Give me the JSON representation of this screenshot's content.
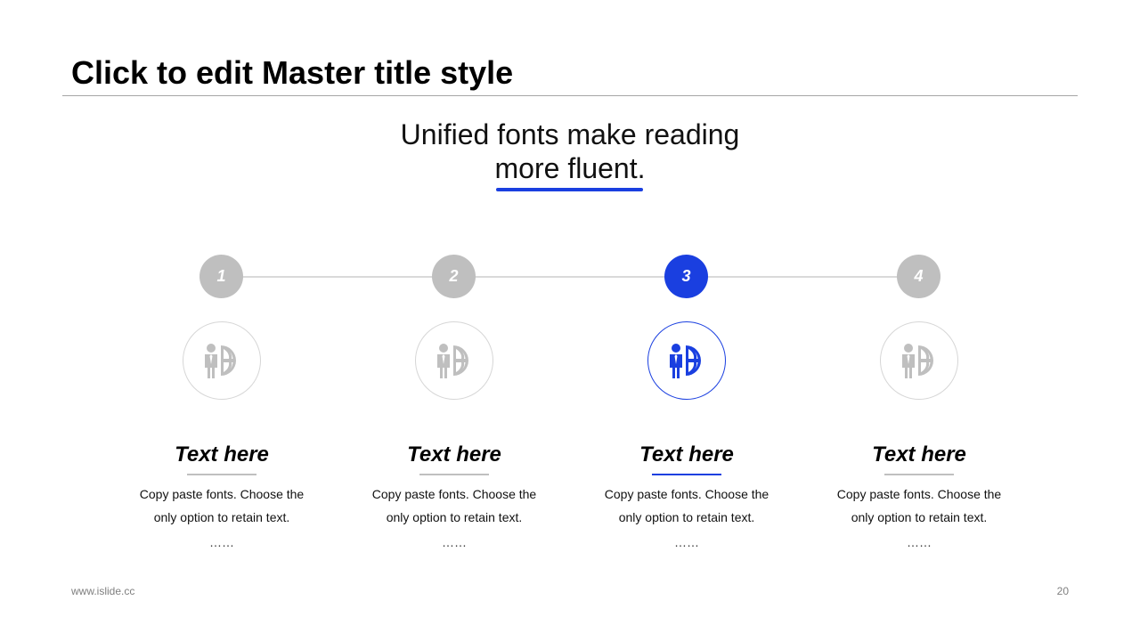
{
  "title": "Click to edit Master title style",
  "subtitle": {
    "line1": "Unified fonts make reading",
    "line2": "more fluent."
  },
  "colors": {
    "accent": "#1a3fe0",
    "inactive": "#bfbfbf",
    "ring": "#d6d6d6",
    "rule": "#a6a6a6"
  },
  "steps": [
    {
      "number": "1",
      "icon": "person-globe-icon",
      "title": "Text here",
      "desc_line1": "Copy paste fonts. Choose the",
      "desc_line2": "only option to retain text.",
      "dots": "……",
      "active": false
    },
    {
      "number": "2",
      "icon": "person-globe-icon",
      "title": "Text here",
      "desc_line1": "Copy paste fonts. Choose the",
      "desc_line2": "only option to retain text.",
      "dots": "……",
      "active": false
    },
    {
      "number": "3",
      "icon": "person-globe-icon",
      "title": "Text here",
      "desc_line1": "Copy paste fonts. Choose the",
      "desc_line2": "only option to retain text.",
      "dots": "……",
      "active": true
    },
    {
      "number": "4",
      "icon": "person-globe-icon",
      "title": "Text here",
      "desc_line1": "Copy paste fonts. Choose the",
      "desc_line2": "only option to retain text.",
      "dots": "……",
      "active": false
    }
  ],
  "footer": {
    "website": "www.islide.cc",
    "page_number": "20"
  }
}
